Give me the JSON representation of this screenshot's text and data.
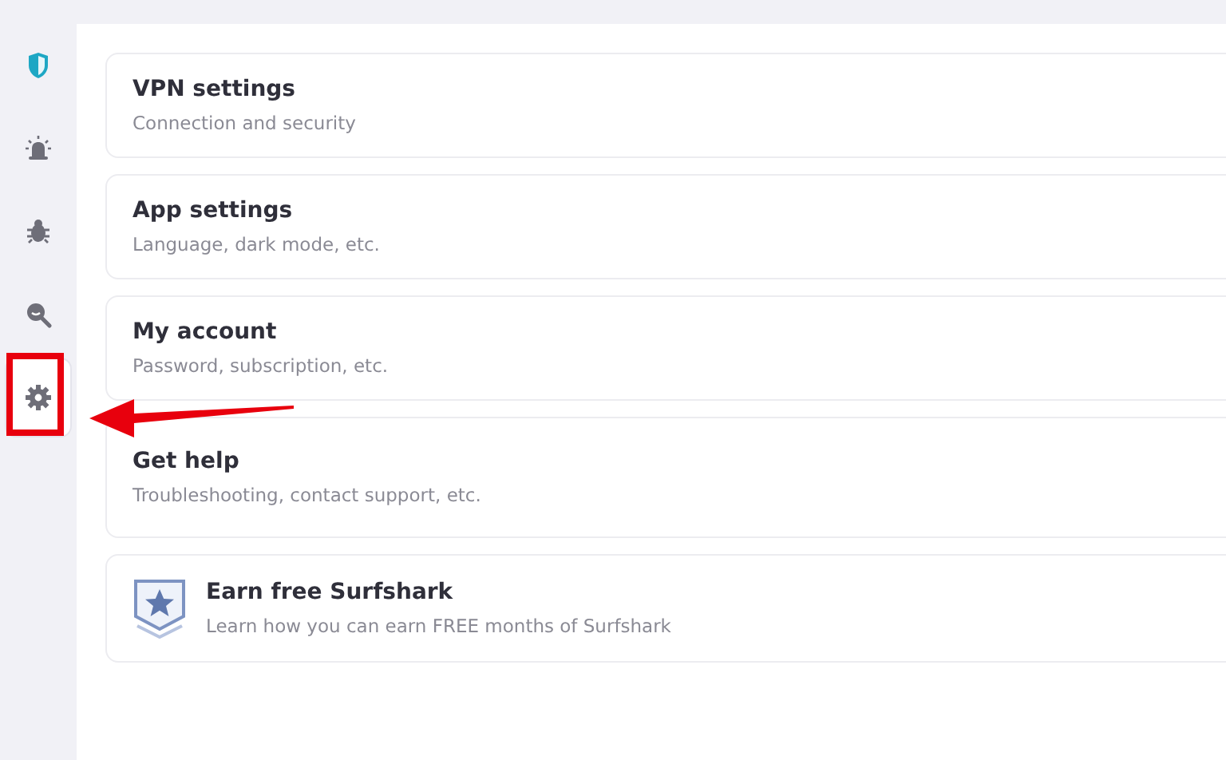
{
  "sidebar": {
    "items": [
      {
        "kind": "shield",
        "selected": false
      },
      {
        "kind": "alarm",
        "selected": false
      },
      {
        "kind": "bug",
        "selected": false
      },
      {
        "kind": "search",
        "selected": false
      },
      {
        "kind": "gear",
        "selected": true
      }
    ]
  },
  "settings": [
    {
      "kind": "plain",
      "title": "VPN settings",
      "subtitle": "Connection and security"
    },
    {
      "kind": "plain",
      "title": "App settings",
      "subtitle": "Language, dark mode, etc."
    },
    {
      "kind": "plain",
      "title": "My account",
      "subtitle": "Password, subscription, etc."
    },
    {
      "kind": "plain",
      "title": "Get help",
      "subtitle": "Troubleshooting, contact support, etc."
    },
    {
      "kind": "badge",
      "title": "Earn free Surfshark",
      "subtitle": "Learn how you can earn FREE months of Surfshark"
    }
  ]
}
